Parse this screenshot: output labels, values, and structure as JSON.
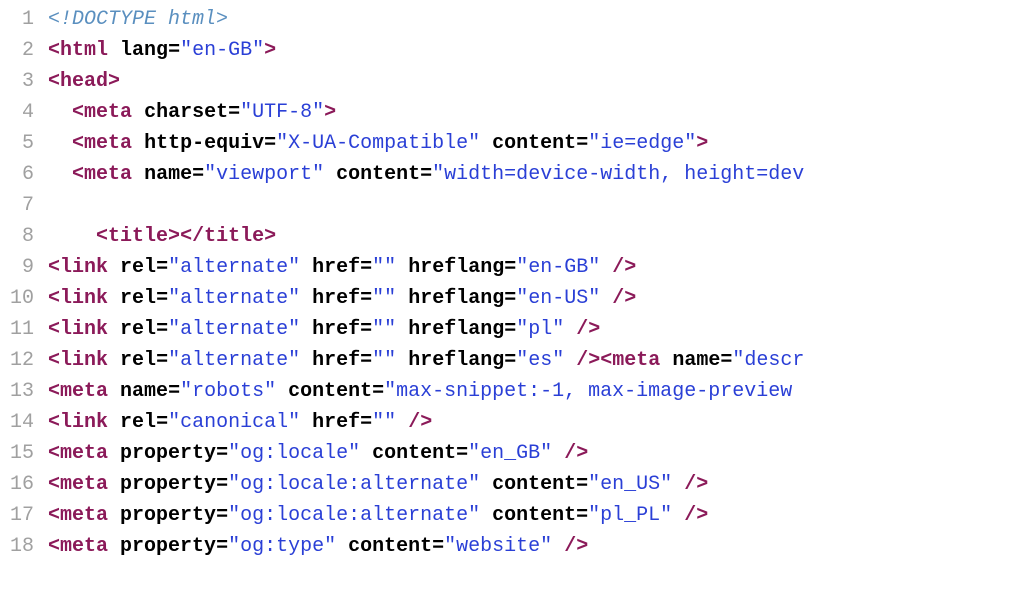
{
  "lines": [
    {
      "num": "1",
      "indent": 0,
      "tokens": [
        [
          "doctype",
          "<!DOCTYPE html>"
        ]
      ]
    },
    {
      "num": "2",
      "indent": 0,
      "tokens": [
        [
          "bracket",
          "<"
        ],
        [
          "tag",
          "html"
        ],
        [
          "space",
          " "
        ],
        [
          "attr",
          "lang"
        ],
        [
          "eq",
          "="
        ],
        [
          "str",
          "\"en-GB\""
        ],
        [
          "bracket",
          ">"
        ]
      ]
    },
    {
      "num": "3",
      "indent": 0,
      "tokens": [
        [
          "bracket",
          "<"
        ],
        [
          "tag",
          "head"
        ],
        [
          "bracket",
          ">"
        ]
      ]
    },
    {
      "num": "4",
      "indent": 2,
      "tokens": [
        [
          "bracket",
          "<"
        ],
        [
          "tag",
          "meta"
        ],
        [
          "space",
          " "
        ],
        [
          "attr",
          "charset"
        ],
        [
          "eq",
          "="
        ],
        [
          "str",
          "\"UTF-8\""
        ],
        [
          "bracket",
          ">"
        ]
      ]
    },
    {
      "num": "5",
      "indent": 2,
      "tokens": [
        [
          "bracket",
          "<"
        ],
        [
          "tag",
          "meta"
        ],
        [
          "space",
          " "
        ],
        [
          "attr",
          "http-equiv"
        ],
        [
          "eq",
          "="
        ],
        [
          "str",
          "\"X-UA-Compatible\""
        ],
        [
          "space",
          " "
        ],
        [
          "attr",
          "content"
        ],
        [
          "eq",
          "="
        ],
        [
          "str",
          "\"ie=edge\""
        ],
        [
          "bracket",
          ">"
        ]
      ]
    },
    {
      "num": "6",
      "indent": 2,
      "tokens": [
        [
          "bracket",
          "<"
        ],
        [
          "tag",
          "meta"
        ],
        [
          "space",
          " "
        ],
        [
          "attr",
          "name"
        ],
        [
          "eq",
          "="
        ],
        [
          "str",
          "\"viewport\""
        ],
        [
          "space",
          " "
        ],
        [
          "attr",
          "content"
        ],
        [
          "eq",
          "="
        ],
        [
          "str",
          "\"width=device-width, height=dev"
        ]
      ]
    },
    {
      "num": "7",
      "indent": 0,
      "tokens": []
    },
    {
      "num": "8",
      "indent": 4,
      "tokens": [
        [
          "bracket",
          "<"
        ],
        [
          "tag",
          "title"
        ],
        [
          "bracket",
          ">"
        ],
        [
          "bracket",
          "</"
        ],
        [
          "tag",
          "title"
        ],
        [
          "bracket",
          ">"
        ]
      ]
    },
    {
      "num": "9",
      "indent": 0,
      "tokens": [
        [
          "bracket",
          "<"
        ],
        [
          "tag",
          "link"
        ],
        [
          "space",
          " "
        ],
        [
          "attr",
          "rel"
        ],
        [
          "eq",
          "="
        ],
        [
          "str",
          "\"alternate\""
        ],
        [
          "space",
          " "
        ],
        [
          "attr",
          "href"
        ],
        [
          "eq",
          "="
        ],
        [
          "str",
          "\"\""
        ],
        [
          "space",
          " "
        ],
        [
          "attr",
          "hreflang"
        ],
        [
          "eq",
          "="
        ],
        [
          "str",
          "\"en-GB\""
        ],
        [
          "space",
          " "
        ],
        [
          "slash",
          "/"
        ],
        [
          "bracket",
          ">"
        ]
      ]
    },
    {
      "num": "10",
      "indent": 0,
      "tokens": [
        [
          "bracket",
          "<"
        ],
        [
          "tag",
          "link"
        ],
        [
          "space",
          " "
        ],
        [
          "attr",
          "rel"
        ],
        [
          "eq",
          "="
        ],
        [
          "str",
          "\"alternate\""
        ],
        [
          "space",
          " "
        ],
        [
          "attr",
          "href"
        ],
        [
          "eq",
          "="
        ],
        [
          "str",
          "\"\""
        ],
        [
          "space",
          " "
        ],
        [
          "attr",
          "hreflang"
        ],
        [
          "eq",
          "="
        ],
        [
          "str",
          "\"en-US\""
        ],
        [
          "space",
          " "
        ],
        [
          "slash",
          "/"
        ],
        [
          "bracket",
          ">"
        ]
      ]
    },
    {
      "num": "11",
      "indent": 0,
      "tokens": [
        [
          "bracket",
          "<"
        ],
        [
          "tag",
          "link"
        ],
        [
          "space",
          " "
        ],
        [
          "attr",
          "rel"
        ],
        [
          "eq",
          "="
        ],
        [
          "str",
          "\"alternate\""
        ],
        [
          "space",
          " "
        ],
        [
          "attr",
          "href"
        ],
        [
          "eq",
          "="
        ],
        [
          "str",
          "\"\""
        ],
        [
          "space",
          " "
        ],
        [
          "attr",
          "hreflang"
        ],
        [
          "eq",
          "="
        ],
        [
          "str",
          "\"pl\""
        ],
        [
          "space",
          " "
        ],
        [
          "slash",
          "/"
        ],
        [
          "bracket",
          ">"
        ]
      ]
    },
    {
      "num": "12",
      "indent": 0,
      "tokens": [
        [
          "bracket",
          "<"
        ],
        [
          "tag",
          "link"
        ],
        [
          "space",
          " "
        ],
        [
          "attr",
          "rel"
        ],
        [
          "eq",
          "="
        ],
        [
          "str",
          "\"alternate\""
        ],
        [
          "space",
          " "
        ],
        [
          "attr",
          "href"
        ],
        [
          "eq",
          "="
        ],
        [
          "str",
          "\"\""
        ],
        [
          "space",
          " "
        ],
        [
          "attr",
          "hreflang"
        ],
        [
          "eq",
          "="
        ],
        [
          "str",
          "\"es\""
        ],
        [
          "space",
          " "
        ],
        [
          "slash",
          "/"
        ],
        [
          "bracket",
          ">"
        ],
        [
          "bracket",
          "<"
        ],
        [
          "tag",
          "meta"
        ],
        [
          "space",
          " "
        ],
        [
          "attr",
          "name"
        ],
        [
          "eq",
          "="
        ],
        [
          "str",
          "\"descr"
        ]
      ]
    },
    {
      "num": "13",
      "indent": 0,
      "tokens": [
        [
          "bracket",
          "<"
        ],
        [
          "tag",
          "meta"
        ],
        [
          "space",
          " "
        ],
        [
          "attr",
          "name"
        ],
        [
          "eq",
          "="
        ],
        [
          "str",
          "\"robots\""
        ],
        [
          "space",
          " "
        ],
        [
          "attr",
          "content"
        ],
        [
          "eq",
          "="
        ],
        [
          "str",
          "\"max-snippet:-1, max-image-preview"
        ]
      ]
    },
    {
      "num": "14",
      "indent": 0,
      "tokens": [
        [
          "bracket",
          "<"
        ],
        [
          "tag",
          "link"
        ],
        [
          "space",
          " "
        ],
        [
          "attr",
          "rel"
        ],
        [
          "eq",
          "="
        ],
        [
          "str",
          "\"canonical\""
        ],
        [
          "space",
          " "
        ],
        [
          "attr",
          "href"
        ],
        [
          "eq",
          "="
        ],
        [
          "str",
          "\"\""
        ],
        [
          "space",
          " "
        ],
        [
          "slash",
          "/"
        ],
        [
          "bracket",
          ">"
        ]
      ]
    },
    {
      "num": "15",
      "indent": 0,
      "tokens": [
        [
          "bracket",
          "<"
        ],
        [
          "tag",
          "meta"
        ],
        [
          "space",
          " "
        ],
        [
          "attr",
          "property"
        ],
        [
          "eq",
          "="
        ],
        [
          "str",
          "\"og:locale\""
        ],
        [
          "space",
          " "
        ],
        [
          "attr",
          "content"
        ],
        [
          "eq",
          "="
        ],
        [
          "str",
          "\"en_GB\""
        ],
        [
          "space",
          " "
        ],
        [
          "slash",
          "/"
        ],
        [
          "bracket",
          ">"
        ]
      ]
    },
    {
      "num": "16",
      "indent": 0,
      "tokens": [
        [
          "bracket",
          "<"
        ],
        [
          "tag",
          "meta"
        ],
        [
          "space",
          " "
        ],
        [
          "attr",
          "property"
        ],
        [
          "eq",
          "="
        ],
        [
          "str",
          "\"og:locale:alternate\""
        ],
        [
          "space",
          " "
        ],
        [
          "attr",
          "content"
        ],
        [
          "eq",
          "="
        ],
        [
          "str",
          "\"en_US\""
        ],
        [
          "space",
          " "
        ],
        [
          "slash",
          "/"
        ],
        [
          "bracket",
          ">"
        ]
      ]
    },
    {
      "num": "17",
      "indent": 0,
      "tokens": [
        [
          "bracket",
          "<"
        ],
        [
          "tag",
          "meta"
        ],
        [
          "space",
          " "
        ],
        [
          "attr",
          "property"
        ],
        [
          "eq",
          "="
        ],
        [
          "str",
          "\"og:locale:alternate\""
        ],
        [
          "space",
          " "
        ],
        [
          "attr",
          "content"
        ],
        [
          "eq",
          "="
        ],
        [
          "str",
          "\"pl_PL\""
        ],
        [
          "space",
          " "
        ],
        [
          "slash",
          "/"
        ],
        [
          "bracket",
          ">"
        ]
      ]
    },
    {
      "num": "18",
      "indent": 0,
      "tokens": [
        [
          "bracket",
          "<"
        ],
        [
          "tag",
          "meta"
        ],
        [
          "space",
          " "
        ],
        [
          "attr",
          "property"
        ],
        [
          "eq",
          "="
        ],
        [
          "str",
          "\"og:type\""
        ],
        [
          "space",
          " "
        ],
        [
          "attr",
          "content"
        ],
        [
          "eq",
          "="
        ],
        [
          "str",
          "\"website\""
        ],
        [
          "space",
          " "
        ],
        [
          "slash",
          "/"
        ],
        [
          "bracket",
          ">"
        ]
      ]
    }
  ]
}
